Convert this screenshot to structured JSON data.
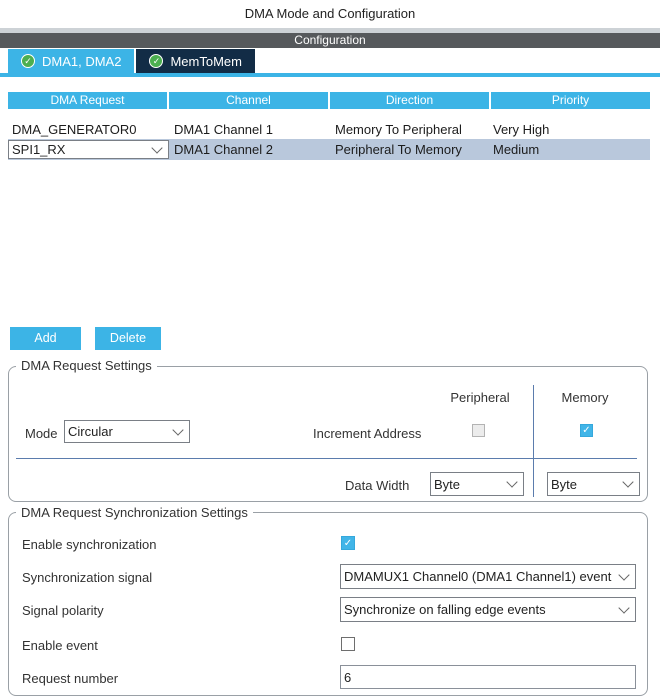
{
  "window": {
    "title": "DMA Mode and Configuration"
  },
  "section_bar": {
    "label": "Configuration"
  },
  "tabs": [
    {
      "label": "DMA1, DMA2",
      "active": false
    },
    {
      "label": "MemToMem",
      "active": true
    }
  ],
  "icons": {
    "checkmark": "✓",
    "chevron": "chevron-down"
  },
  "colors": {
    "accent_blue": "#3CB4E6",
    "dark_tab": "#122C46",
    "header_bar": "#56595C",
    "selected_row": "#B9C8DC",
    "check_green": "#4CAF50",
    "separator_blue": "#5B7CAD"
  },
  "table": {
    "headers": [
      "DMA Request",
      "Channel",
      "Direction",
      "Priority"
    ],
    "rows": [
      {
        "dma_request": "DMA_GENERATOR0",
        "channel": "DMA1 Channel 1",
        "direction": "Memory To Peripheral",
        "priority": "Very High",
        "selected": false
      },
      {
        "dma_request": "SPI1_RX",
        "channel": "DMA1 Channel 2",
        "direction": "Peripheral To Memory",
        "priority": "Medium",
        "selected": true
      }
    ]
  },
  "actions": {
    "add": "Add",
    "delete": "Delete"
  },
  "request_settings": {
    "legend": "DMA Request Settings",
    "peripheral_header": "Peripheral",
    "memory_header": "Memory",
    "mode_label": "Mode",
    "mode_value": "Circular",
    "increment_address_label": "Increment Address",
    "increment_peripheral_checked": false,
    "increment_memory_checked": true,
    "data_width_label": "Data Width",
    "data_width_peripheral": "Byte",
    "data_width_memory": "Byte"
  },
  "sync_settings": {
    "legend": "DMA Request Synchronization Settings",
    "enable_sync_label": "Enable synchronization",
    "enable_sync_checked": true,
    "sync_signal_label": "Synchronization signal",
    "sync_signal_value": "DMAMUX1 Channel0 (DMA1 Channel1) event",
    "signal_polarity_label": "Signal polarity",
    "signal_polarity_value": "Synchronize on falling edge events",
    "enable_event_label": "Enable event",
    "enable_event_checked": false,
    "request_number_label": "Request number",
    "request_number_value": "6"
  }
}
